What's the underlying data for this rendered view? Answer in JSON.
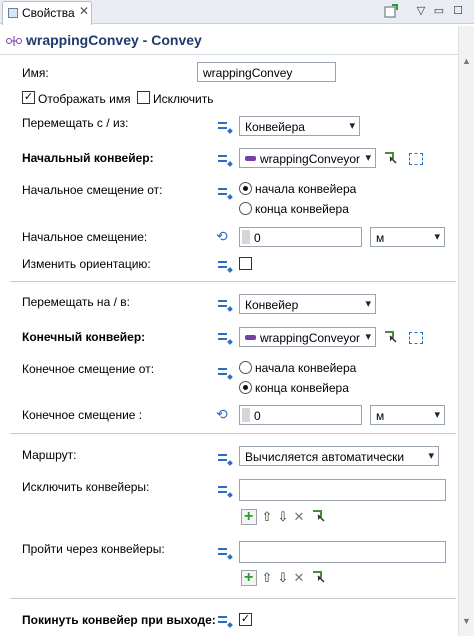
{
  "tab": {
    "label": "Свойства",
    "close": "✕"
  },
  "toolbar": {
    "new_icon": "new-view-icon",
    "minimize": "▭",
    "menu": "▽",
    "maximize": "☐"
  },
  "header": {
    "title": "wrappingConvey - Convey"
  },
  "name": {
    "label": "Имя:",
    "value": "wrappingConvey"
  },
  "show_name": {
    "label": "Отображать имя",
    "checked": true
  },
  "exclude": {
    "label": "Исключить",
    "checked": false
  },
  "move_from": {
    "label": "Перемещать с / из:",
    "value": "Конвейера"
  },
  "start_conveyor": {
    "label": "Начальный конвейер:",
    "value": "wrappingConveyor"
  },
  "start_offset_from": {
    "label": "Начальное смещение от:",
    "options": [
      "начала конвейера",
      "конца конвейера"
    ],
    "selected": 0
  },
  "start_offset": {
    "label": "Начальное смещение:",
    "value": "0",
    "unit": "м"
  },
  "change_orientation": {
    "label": "Изменить ориентацию:",
    "checked": false
  },
  "move_to": {
    "label": "Перемещать на / в:",
    "value": "Конвейер"
  },
  "end_conveyor": {
    "label": "Конечный конвейер:",
    "value": "wrappingConveyor"
  },
  "end_offset_from": {
    "label": "Конечное смещение от:",
    "options": [
      "начала конвейера",
      "конца конвейера"
    ],
    "selected": 1
  },
  "end_offset": {
    "label": "Конечное смещение :",
    "value": "0",
    "unit": "м"
  },
  "route": {
    "label": "Маршрут:",
    "value": "Вычисляется автоматически"
  },
  "exclude_conveyors": {
    "label": "Исключить конвейеры:"
  },
  "pass_conveyors": {
    "label": "Пройти через конвейеры:"
  },
  "leave_conveyor": {
    "label": "Покинуть конвейер при выходе:",
    "checked": true
  },
  "glyphs": {
    "dropdown": "▾",
    "check": "✓",
    "up": "⇧",
    "down": "⇩",
    "remove": "✕",
    "plus": "+",
    "dyn": "⟲"
  },
  "colors": {
    "title": "#1f3a6a",
    "accent": "#2b6fc0",
    "conveyor_chip": "#7a3ea8",
    "add_green": "#2a9d2a"
  }
}
